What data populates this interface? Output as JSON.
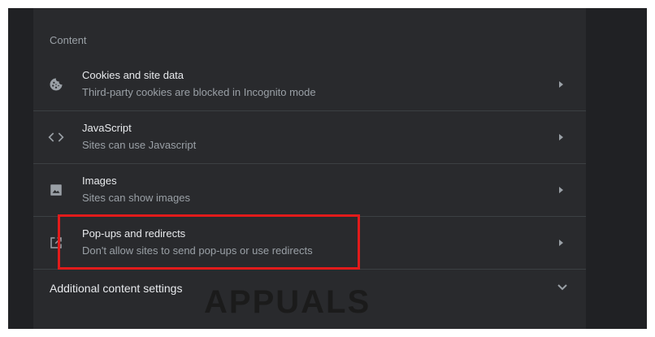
{
  "content": {
    "section_title": "Content",
    "rows": [
      {
        "icon": "cookie-icon",
        "title": "Cookies and site data",
        "subtitle": "Third-party cookies are blocked in Incognito mode"
      },
      {
        "icon": "code-icon",
        "title": "JavaScript",
        "subtitle": "Sites can use Javascript"
      },
      {
        "icon": "image-icon",
        "title": "Images",
        "subtitle": "Sites can show images"
      },
      {
        "icon": "open-in-new-icon",
        "title": "Pop-ups and redirects",
        "subtitle": "Don't allow sites to send pop-ups or use redirects"
      }
    ],
    "additional_label": "Additional content settings"
  },
  "watermark": {
    "text": "APPUALS"
  },
  "colors": {
    "background": "#202124",
    "panel": "#292a2d",
    "primary_text": "#e8eaed",
    "secondary_text": "#9aa0a6",
    "highlight": "#e21b1b"
  }
}
